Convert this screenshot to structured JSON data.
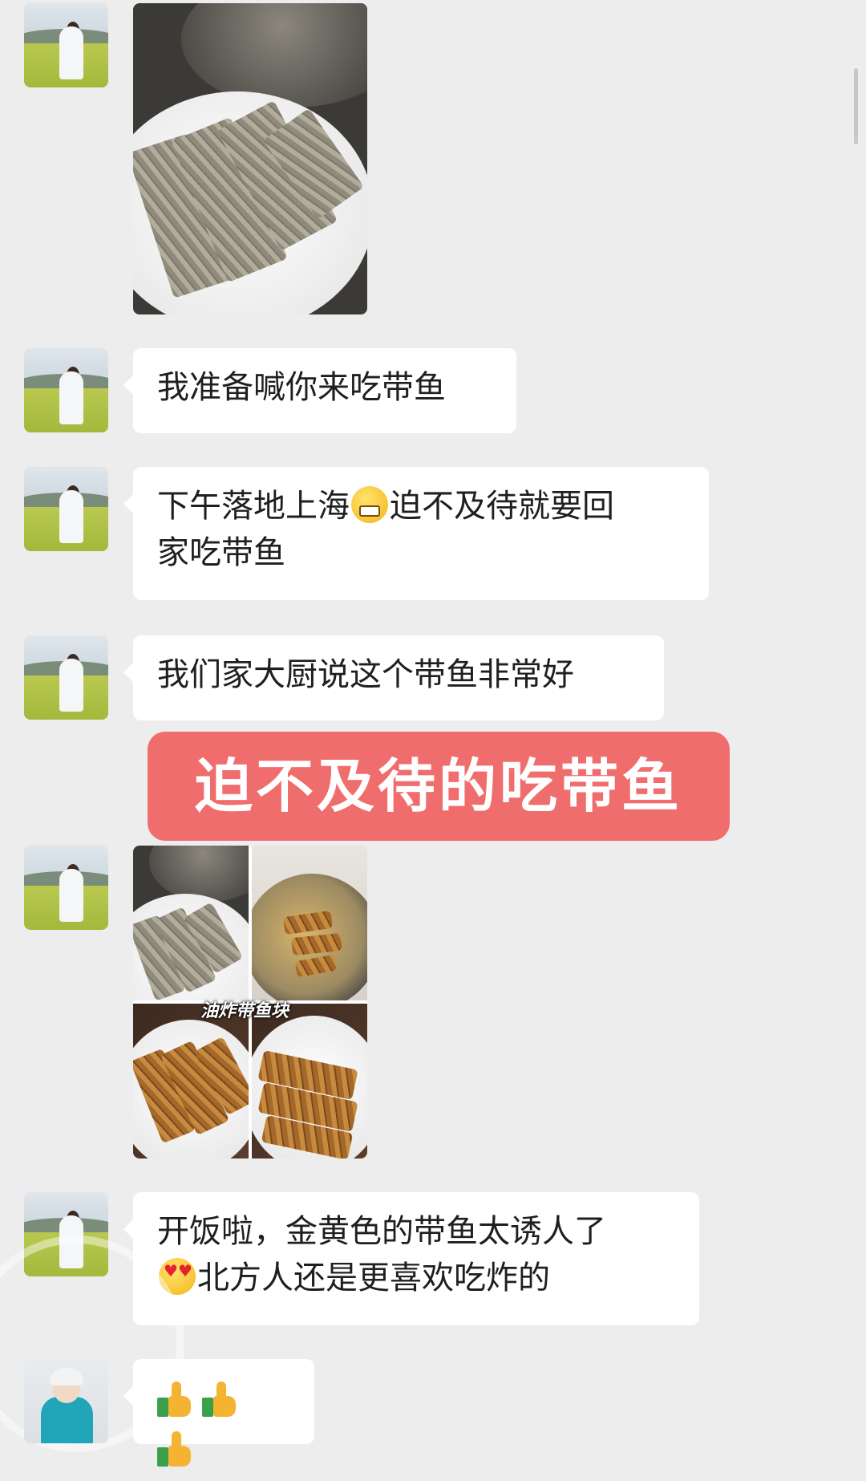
{
  "messages": [
    {
      "type": "image",
      "description_alt": ""
    },
    {
      "type": "text",
      "text": "我准备喊你来吃带鱼"
    },
    {
      "type": "text",
      "line1": "下午落地上海",
      "line1b": "迫不及待就要回",
      "line2": "家吃带鱼",
      "emoji": "grinning-face"
    },
    {
      "type": "text",
      "text": "我们家大厨说这个带鱼非常好"
    },
    {
      "type": "image-collage",
      "overlay_label": "油炸带鱼块"
    },
    {
      "type": "text",
      "line1": "开饭啦，金黄色的带鱼太诱人了",
      "line2": "北方人还是更喜欢吃炸的",
      "emoji": "heart-eyes-face"
    },
    {
      "type": "emoji-only",
      "emoji": "thumbs-up",
      "count": 3
    }
  ],
  "caption": {
    "text": "迫不及待的吃带鱼",
    "color": "#f06d6d"
  },
  "colors": {
    "background": "#ededed",
    "bubble": "#ffffff"
  }
}
